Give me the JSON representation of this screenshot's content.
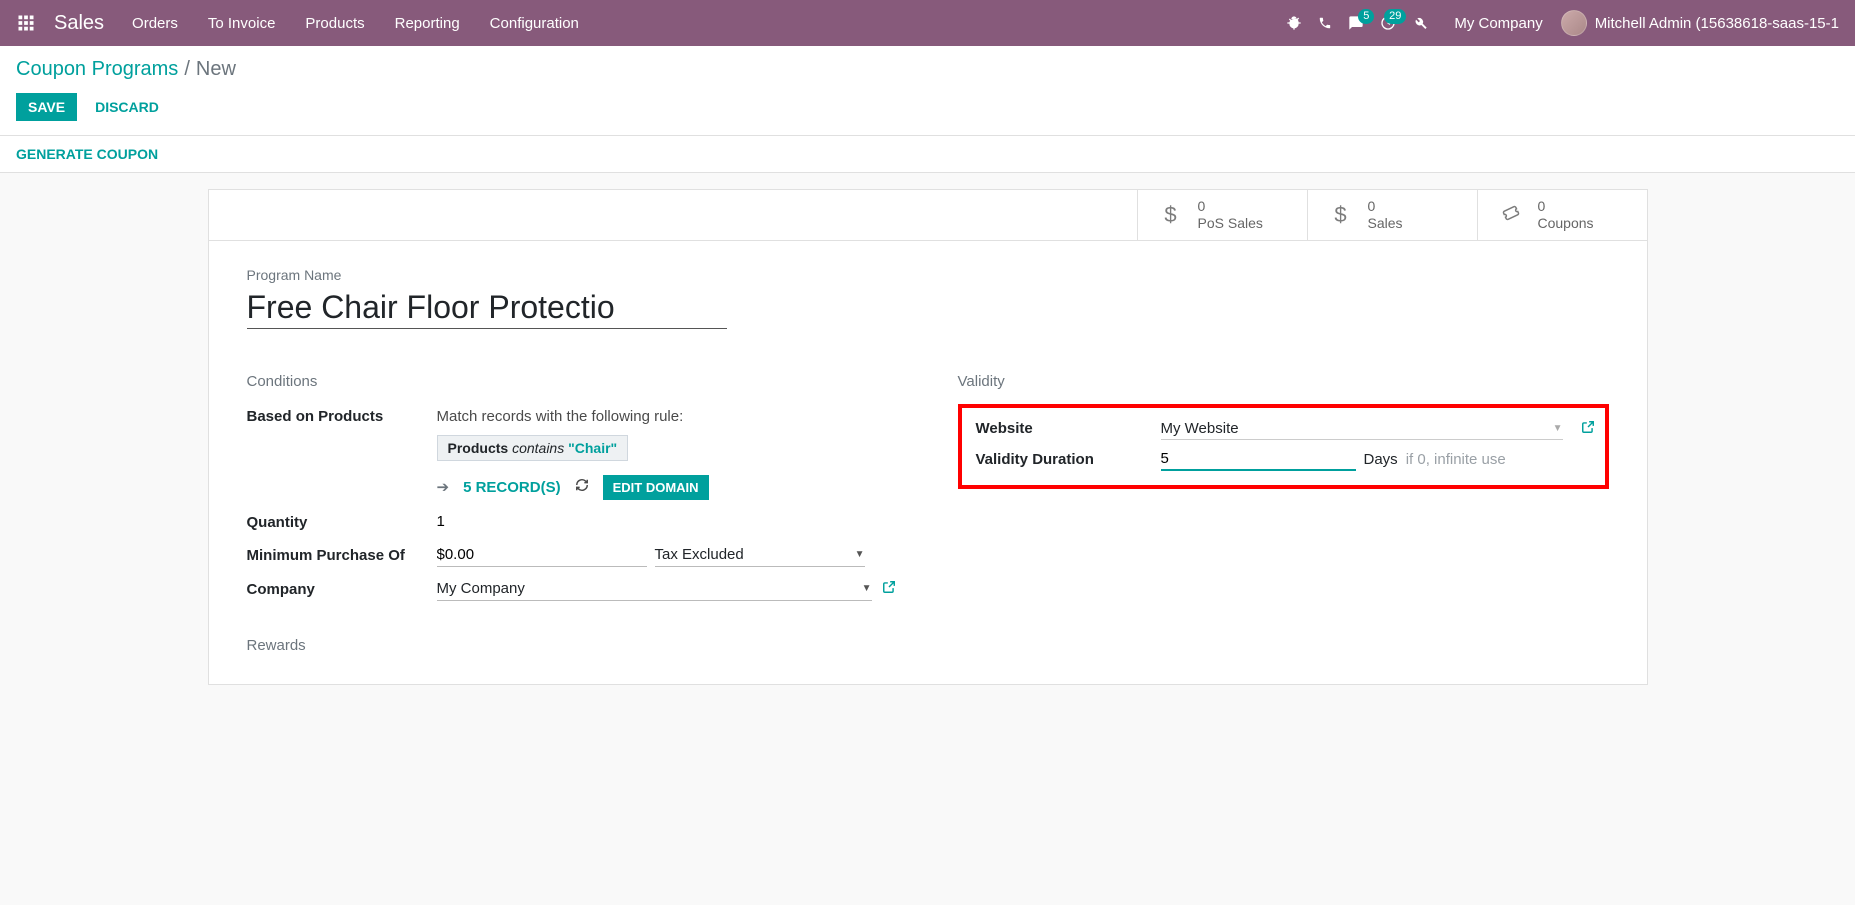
{
  "nav": {
    "brand": "Sales",
    "links": [
      "Orders",
      "To Invoice",
      "Products",
      "Reporting",
      "Configuration"
    ],
    "messages_badge": "5",
    "activities_badge": "29",
    "company": "My Company",
    "user": "Mitchell Admin (15638618-saas-15-1"
  },
  "breadcrumb": {
    "root": "Coupon Programs",
    "sep": "/",
    "current": "New"
  },
  "actions": {
    "save": "SAVE",
    "discard": "DISCARD",
    "generate": "GENERATE COUPON"
  },
  "stats": {
    "pos": {
      "val": "0",
      "label": "PoS Sales"
    },
    "sales": {
      "val": "0",
      "label": "Sales"
    },
    "coupons": {
      "val": "0",
      "label": "Coupons"
    }
  },
  "form": {
    "program_name_label": "Program Name",
    "program_name": "Free Chair Floor Protectio",
    "conditions_title": "Conditions",
    "validity_title": "Validity",
    "rewards_title": "Rewards",
    "based_on_label": "Based on Products",
    "domain_desc": "Match records with the following rule:",
    "domain_prefix": "Products",
    "domain_op": "contains",
    "domain_value": "\"Chair\"",
    "records": "5 RECORD(S)",
    "edit_domain": "EDIT DOMAIN",
    "quantity_label": "Quantity",
    "quantity": "1",
    "min_purchase_label": "Minimum Purchase Of",
    "min_purchase": "$0.00",
    "tax_mode": "Tax Excluded",
    "company_label": "Company",
    "company": "My Company",
    "website_label": "Website",
    "website": "My Website",
    "validity_label": "Validity Duration",
    "validity_duration": "5",
    "days": "Days",
    "validity_hint": "if 0, infinite use"
  }
}
